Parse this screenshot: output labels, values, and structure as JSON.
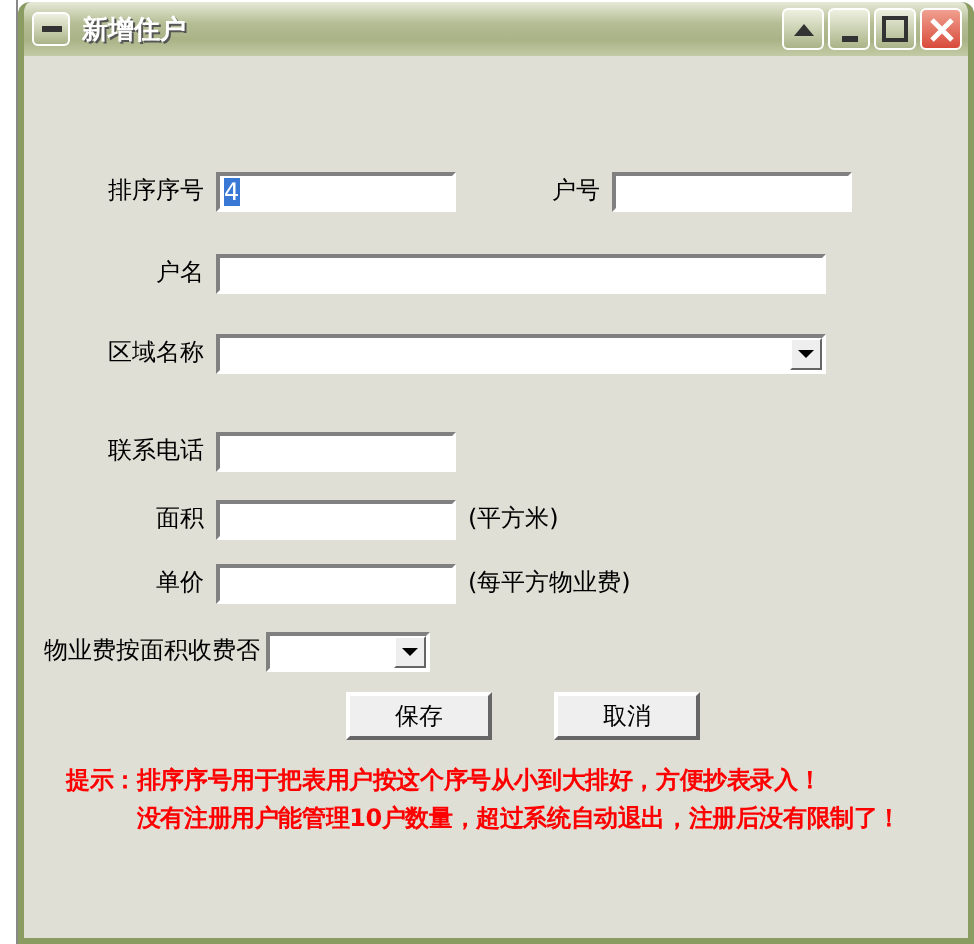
{
  "window": {
    "title": "新增住户"
  },
  "rows": [
    {
      "fields": [
        {
          "kind": "text",
          "label": "排序序号",
          "value": "4",
          "value_selected": true
        },
        {
          "kind": "text",
          "label": "户号"
        }
      ]
    },
    {
      "fields": [
        {
          "kind": "text",
          "label": "户名"
        }
      ]
    },
    {
      "fields": [
        {
          "kind": "select",
          "label": "区域名称"
        }
      ]
    },
    {
      "fields": [
        {
          "kind": "text",
          "label": "联系电话"
        }
      ]
    },
    {
      "fields": [
        {
          "kind": "text",
          "label": "面积",
          "suffix": "(平方米)"
        }
      ]
    },
    {
      "fields": [
        {
          "kind": "text",
          "label": "单价",
          "suffix": "(每平方物业费)"
        }
      ]
    },
    {
      "fields": [
        {
          "kind": "select",
          "label": "物业费按面积收费否"
        }
      ]
    }
  ],
  "buttons": [
    "保存",
    "取消"
  ],
  "tip": {
    "prefix": "提示：",
    "lines": [
      "排序序号用于把表用户按这个序号从小到大排好，方便抄表录入！",
      "没有注册用户能管理10户数量，超过系统自动退出，注册后没有限制了！"
    ]
  }
}
